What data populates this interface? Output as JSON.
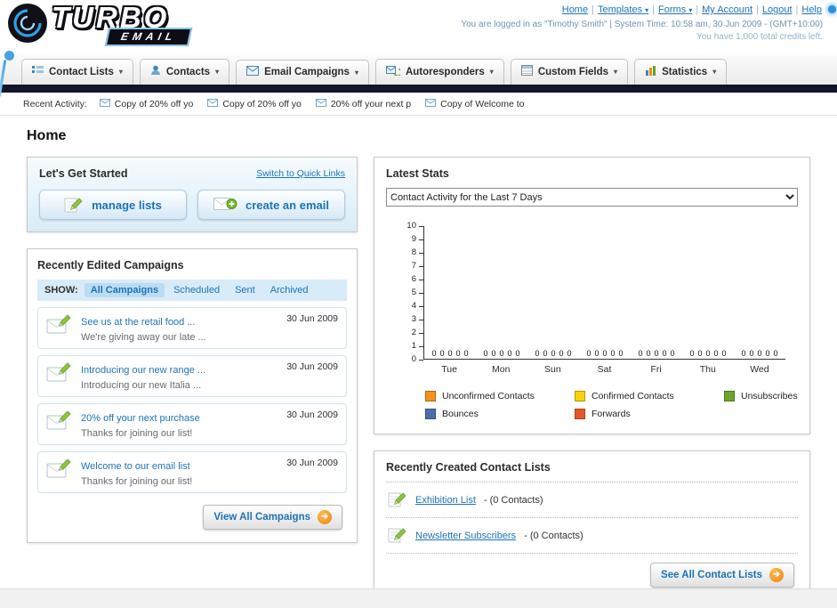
{
  "icons": {
    "dropdown_arrow": "▾",
    "forward_arrow": "➔",
    "separator": "|"
  },
  "header": {
    "logo_primary": "TURBO",
    "logo_secondary": "EMAIL",
    "links": [
      {
        "label": "Home"
      },
      {
        "label": "Templates"
      },
      {
        "label": "Forms"
      },
      {
        "label": "My Account"
      },
      {
        "label": "Logout"
      },
      {
        "label": "Help"
      }
    ],
    "login_info": "You are logged in as \"Timothy Smith\" | System Time: 10:58 am, 30 Jun 2009 - (GMT+10:00)",
    "credits_info": "You have 1,000 total credits left."
  },
  "nav_tabs": [
    {
      "label": "Contact Lists"
    },
    {
      "label": "Contacts"
    },
    {
      "label": "Email Campaigns"
    },
    {
      "label": "Autoresponders"
    },
    {
      "label": "Custom Fields"
    },
    {
      "label": "Statistics"
    }
  ],
  "recent_activity": {
    "label": "Recent Activity:",
    "items": [
      "Copy of 20% off yo",
      "Copy of 20% off yo",
      "20% off your next p",
      "Copy of Welcome to"
    ]
  },
  "page_title": "Home",
  "get_started": {
    "title": "Let's Get Started",
    "switch_link": "Switch to Quick Links",
    "manage_lists": "manage lists",
    "create_email": "create an email"
  },
  "campaigns": {
    "title": "Recently Edited Campaigns",
    "show_label": "SHOW:",
    "filters": [
      "All Campaigns",
      "Scheduled",
      "Sent",
      "Archived"
    ],
    "items": [
      {
        "title": "See us at the retail food ...",
        "subtitle": "We're giving away our late ...",
        "date": "30 Jun 2009"
      },
      {
        "title": "Introducing our new range ...",
        "subtitle": "Introducing our new Italia ...",
        "date": "30 Jun 2009"
      },
      {
        "title": "20% off your next purchase",
        "subtitle": "Thanks for joining our list!",
        "date": "30 Jun 2009"
      },
      {
        "title": "Welcome to our email list",
        "subtitle": "Thanks for joining our list!",
        "date": "30 Jun 2009"
      }
    ],
    "view_all": "View All Campaigns"
  },
  "latest_stats": {
    "title": "Latest Stats",
    "period_selected": "Contact Activity for the Last 7 Days"
  },
  "chart_data": {
    "type": "bar",
    "title": "Contact Activity for the Last 7 Days",
    "categories": [
      "Tue",
      "Mon",
      "Sun",
      "Sat",
      "Fri",
      "Thu",
      "Wed"
    ],
    "series": [
      {
        "name": "Unconfirmed Contacts",
        "color": "#f6911e",
        "values": [
          0,
          0,
          0,
          0,
          0,
          0,
          0
        ]
      },
      {
        "name": "Confirmed Contacts",
        "color": "#f8d20a",
        "values": [
          0,
          0,
          0,
          0,
          0,
          0,
          0
        ]
      },
      {
        "name": "Unsubscribes",
        "color": "#6fa32a",
        "values": [
          0,
          0,
          0,
          0,
          0,
          0,
          0
        ]
      },
      {
        "name": "Bounces",
        "color": "#4d6fa8",
        "values": [
          0,
          0,
          0,
          0,
          0,
          0,
          0
        ]
      },
      {
        "name": "Forwards",
        "color": "#e9562b",
        "values": [
          0,
          0,
          0,
          0,
          0,
          0,
          0
        ]
      }
    ],
    "ylim": [
      0,
      10
    ],
    "ytick_step": 1,
    "grid": false,
    "legend_position": "bottom",
    "value_labels_shown": true
  },
  "contact_lists": {
    "title": "Recently Created Contact Lists",
    "items": [
      {
        "name": "Exhibition List",
        "detail": "- (0 Contacts)"
      },
      {
        "name": "Newsletter Subscribers",
        "detail": "- (0 Contacts)"
      }
    ],
    "see_all": "See All Contact Lists"
  }
}
